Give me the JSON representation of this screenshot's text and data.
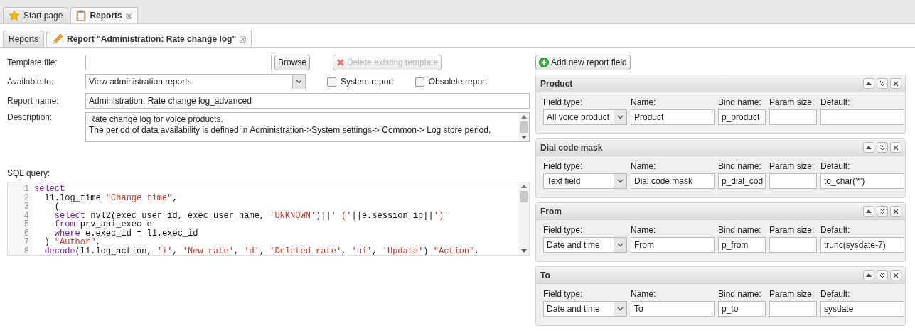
{
  "top_tabs": [
    {
      "label": "Start page",
      "selected": false,
      "closable": false
    },
    {
      "label": "Reports",
      "selected": true,
      "closable": true
    }
  ],
  "sub_tabs": [
    {
      "label": "Reports",
      "selected": false,
      "closable": false
    },
    {
      "label": "Report \"Administration: Rate change log\"",
      "selected": true,
      "closable": true
    }
  ],
  "form": {
    "template_file": {
      "label": "Template file:",
      "browse": "Browse"
    },
    "delete_template": {
      "label": "Delete existing template",
      "disabled": true
    },
    "available_to": {
      "label": "Available to:",
      "value": "View administration reports"
    },
    "checkboxes": [
      {
        "label": "System report",
        "checked": false
      },
      {
        "label": "Obsolete report",
        "checked": false
      }
    ],
    "report_name": {
      "label": "Report name:",
      "value": "Administration: Rate change log_advanced"
    },
    "description": {
      "label": "Description:",
      "lines": [
        "Rate change log for voice products.",
        "The period of data availability is defined in Administration->System settings-> Common-> Log store period,"
      ]
    },
    "sql": {
      "label": "SQL query:",
      "lines": [
        [
          {
            "kind": "keyword",
            "t": "select"
          }
        ],
        [
          {
            "kind": "plain",
            "t": "  l1.log_time "
          },
          {
            "kind": "string",
            "t": "\"Change time\""
          },
          {
            "kind": "plain",
            "t": ","
          }
        ],
        [
          {
            "kind": "plain",
            "t": "    ("
          }
        ],
        [
          {
            "kind": "keyword",
            "t": "    select "
          },
          {
            "kind": "plain",
            "t": "nvl2(exec_user_id, exec_user_name, "
          },
          {
            "kind": "string",
            "t": "'UNKNOWN'"
          },
          {
            "kind": "plain",
            "t": ")||"
          },
          {
            "kind": "string",
            "t": "' ('"
          },
          {
            "kind": "plain",
            "t": "||e.session_ip||"
          },
          {
            "kind": "string",
            "t": "')'"
          }
        ],
        [
          {
            "kind": "keyword",
            "t": "    from "
          },
          {
            "kind": "plain",
            "t": "prv_api_exec e"
          }
        ],
        [
          {
            "kind": "keyword",
            "t": "    where "
          },
          {
            "kind": "plain",
            "t": "e.exec_id = l1.exec_id"
          }
        ],
        [
          {
            "kind": "plain",
            "t": "  ) "
          },
          {
            "kind": "string",
            "t": "\"Author\""
          },
          {
            "kind": "plain",
            "t": ","
          }
        ],
        [
          {
            "kind": "keyword",
            "t": "  decode"
          },
          {
            "kind": "plain",
            "t": "(l1.log_action, "
          },
          {
            "kind": "string",
            "t": "'i'"
          },
          {
            "kind": "plain",
            "t": ", "
          },
          {
            "kind": "string",
            "t": "'New rate'"
          },
          {
            "kind": "plain",
            "t": ", "
          },
          {
            "kind": "string",
            "t": "'d'"
          },
          {
            "kind": "plain",
            "t": ", "
          },
          {
            "kind": "string",
            "t": "'Deleted rate'"
          },
          {
            "kind": "plain",
            "t": ", "
          },
          {
            "kind": "string",
            "t": "'ui'"
          },
          {
            "kind": "plain",
            "t": ", "
          },
          {
            "kind": "string",
            "t": "'Update'"
          },
          {
            "kind": "plain",
            "t": ") "
          },
          {
            "kind": "string",
            "t": "\"Action\""
          },
          {
            "kind": "plain",
            "t": ","
          }
        ]
      ],
      "line_numbers": [
        "1",
        "2",
        "3",
        "4",
        "5",
        "6",
        "7",
        "8"
      ]
    }
  },
  "add_field_button": "Add new report field",
  "report_fields": [
    {
      "title": "Product",
      "labels": [
        "Field type:",
        "Name:",
        "Bind name:",
        "Param size:",
        "Default:"
      ],
      "field_type": "All voice product",
      "name": "Product",
      "bind_name": "p_product"
    },
    {
      "title": "Dial code mask",
      "labels": [
        "Field type:",
        "Name:",
        "Bind name:",
        "Param size:",
        "Default:"
      ],
      "field_type": "Text field",
      "name": "Dial code mask",
      "bind_name": "p_dial_cod",
      "default": "to_char('*')"
    },
    {
      "title": "From",
      "labels": [
        "Field type:",
        "Name:",
        "Bind name:",
        "Param size:",
        "Default:"
      ],
      "field_type": "Date and time",
      "name": "From",
      "bind_name": "p_from",
      "default": "trunc(sysdate-7)"
    },
    {
      "title": "To",
      "labels": [
        "Field type:",
        "Name:",
        "Bind name:",
        "Param size:",
        "Default:"
      ],
      "field_type": "Date and time",
      "name": "To",
      "bind_name": "p_to",
      "default": "sysdate"
    }
  ]
}
